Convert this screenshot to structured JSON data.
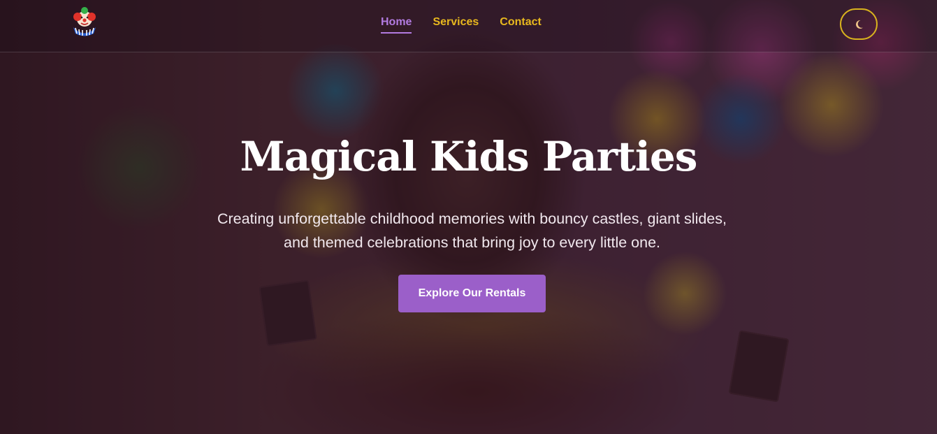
{
  "nav": {
    "items": [
      {
        "label": "Home"
      },
      {
        "label": "Services"
      },
      {
        "label": "Contact"
      }
    ]
  },
  "theme_toggle": {
    "icon": "moon-icon"
  },
  "hero": {
    "title": "Magical Kids Parties",
    "subtitle": "Creating unforgettable childhood memories with bouncy castles, giant slides, and themed celebrations that bring joy to every little one.",
    "cta_label": "Explore Our Rentals"
  },
  "colors": {
    "accent_purple": "#9b5fc9",
    "nav_gold": "#e8b81e",
    "nav_active": "#b27be0"
  }
}
